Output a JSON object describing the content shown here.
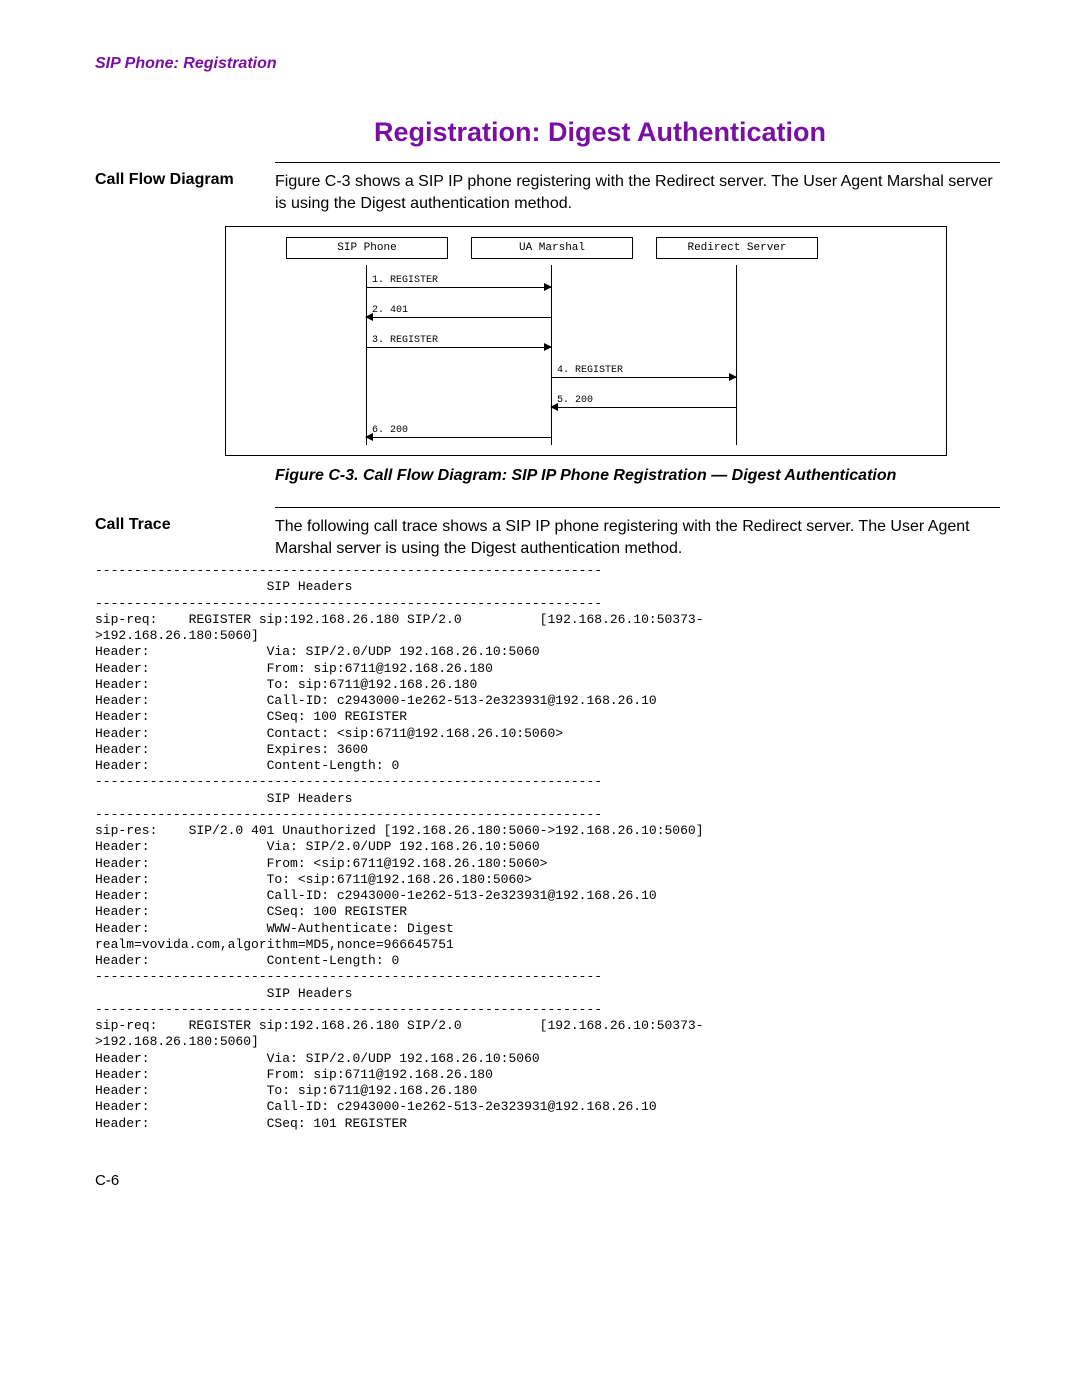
{
  "section_header": "SIP Phone: Registration",
  "page_title": "Registration: Digest Authentication",
  "call_flow": {
    "label": "Call Flow Diagram",
    "body": "Figure C-3 shows a SIP IP phone registering with the Redirect server. The User Agent Marshal server is using the Digest authentication method."
  },
  "diagram": {
    "actors": [
      "SIP Phone",
      "UA Marshal",
      "Redirect Server"
    ],
    "messages": [
      {
        "n": "1.",
        "text": "REGISTER"
      },
      {
        "n": "2.",
        "text": "401"
      },
      {
        "n": "3.",
        "text": "REGISTER"
      },
      {
        "n": "4.",
        "text": "REGISTER"
      },
      {
        "n": "5.",
        "text": "200"
      },
      {
        "n": "6.",
        "text": "200"
      }
    ]
  },
  "figure_caption": "Figure C-3. Call Flow Diagram: SIP IP Phone Registration — Digest Authentication",
  "call_trace": {
    "label": "Call Trace",
    "body": "The following call trace shows a SIP IP phone registering with the Redirect server. The User Agent Marshal server is using the Digest authentication method."
  },
  "trace_text": "-----------------------------------------------------------------\n                      SIP Headers\n-----------------------------------------------------------------\nsip-req:    REGISTER sip:192.168.26.180 SIP/2.0          [192.168.26.10:50373-\n>192.168.26.180:5060]\nHeader:               Via: SIP/2.0/UDP 192.168.26.10:5060\nHeader:               From: sip:6711@192.168.26.180\nHeader:               To: sip:6711@192.168.26.180\nHeader:               Call-ID: c2943000-1e262-513-2e323931@192.168.26.10\nHeader:               CSeq: 100 REGISTER\nHeader:               Contact: <sip:6711@192.168.26.10:5060>\nHeader:               Expires: 3600\nHeader:               Content-Length: 0\n-----------------------------------------------------------------\n                      SIP Headers\n-----------------------------------------------------------------\nsip-res:    SIP/2.0 401 Unauthorized [192.168.26.180:5060->192.168.26.10:5060]\nHeader:               Via: SIP/2.0/UDP 192.168.26.10:5060\nHeader:               From: <sip:6711@192.168.26.180:5060>\nHeader:               To: <sip:6711@192.168.26.180:5060>\nHeader:               Call-ID: c2943000-1e262-513-2e323931@192.168.26.10\nHeader:               CSeq: 100 REGISTER\nHeader:               WWW-Authenticate: Digest\nrealm=vovida.com,algorithm=MD5,nonce=966645751\nHeader:               Content-Length: 0\n-----------------------------------------------------------------\n                      SIP Headers\n-----------------------------------------------------------------\nsip-req:    REGISTER sip:192.168.26.180 SIP/2.0          [192.168.26.10:50373-\n>192.168.26.180:5060]\nHeader:               Via: SIP/2.0/UDP 192.168.26.10:5060\nHeader:               From: sip:6711@192.168.26.180\nHeader:               To: sip:6711@192.168.26.180\nHeader:               Call-ID: c2943000-1e262-513-2e323931@192.168.26.10\nHeader:               CSeq: 101 REGISTER",
  "page_number": "C-6"
}
